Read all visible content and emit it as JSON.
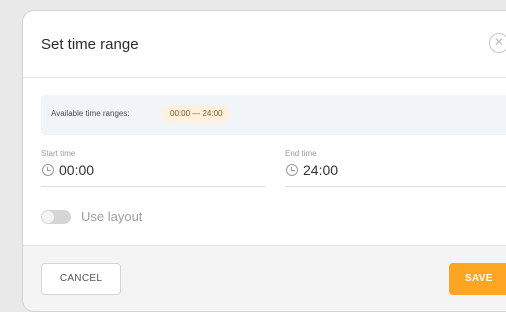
{
  "dialog": {
    "title": "Set time range",
    "close_icon": "close-icon",
    "available": {
      "label": "Available time ranges:",
      "range": "00:00 — 24:00"
    },
    "start": {
      "label": "Start time",
      "value": "00:00",
      "icon": "clock-icon"
    },
    "end": {
      "label": "End time",
      "value": "24:00",
      "icon": "clock-icon"
    },
    "layout_toggle": {
      "label": "Use layout",
      "on": false
    },
    "footer": {
      "cancel_label": "CANCEL",
      "save_label": "SAVE"
    }
  },
  "colors": {
    "accent": "#ffa524",
    "banner_bg": "#f1f5fa",
    "chip_bg": "#fff1dd"
  }
}
